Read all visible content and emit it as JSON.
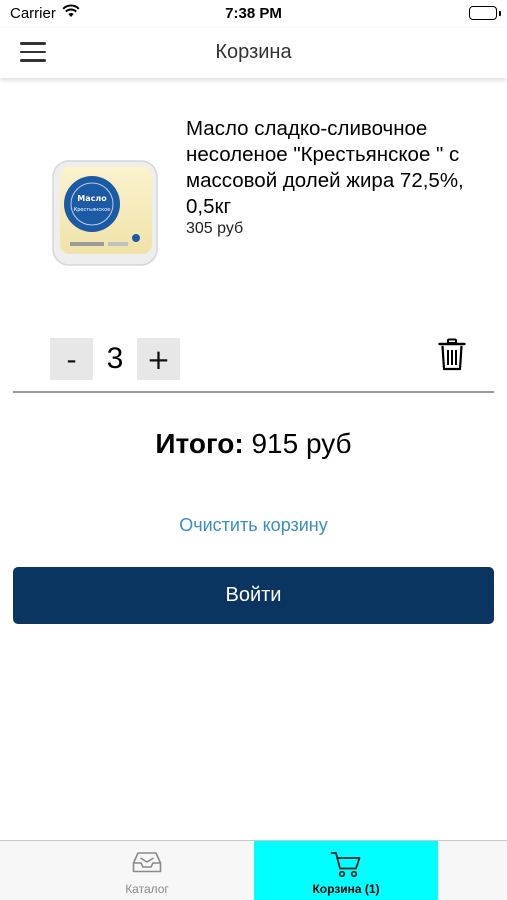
{
  "status_bar": {
    "carrier": "Carrier",
    "time": "7:38 PM"
  },
  "header": {
    "title": "Корзина",
    "menu_icon": "hamburger-menu-icon"
  },
  "cart_item": {
    "title": "Масло сладко-сливочное несоленое \"Крестьянское \" с массовой долей жира 72,5%, 0,5кг",
    "price": "305 руб",
    "quantity": "3",
    "decrement_label": "-",
    "increment_label": "+",
    "remove_icon": "trash-icon",
    "image_label_line1": "Масло",
    "image_label_line2": "Крестьянское"
  },
  "summary": {
    "total_label": "Итого:",
    "total_value": "915 руб"
  },
  "actions": {
    "clear_cart": "Очистить корзину",
    "login": "Войти"
  },
  "tab_bar": {
    "tabs": [
      {
        "label": "Каталог",
        "icon": "inbox-icon",
        "active": false
      },
      {
        "label": "Корзина (1)",
        "icon": "cart-icon",
        "active": true
      }
    ]
  },
  "colors": {
    "primary": "#0b3561",
    "link": "#3a8fc0",
    "active_tab": "#00ffff"
  }
}
